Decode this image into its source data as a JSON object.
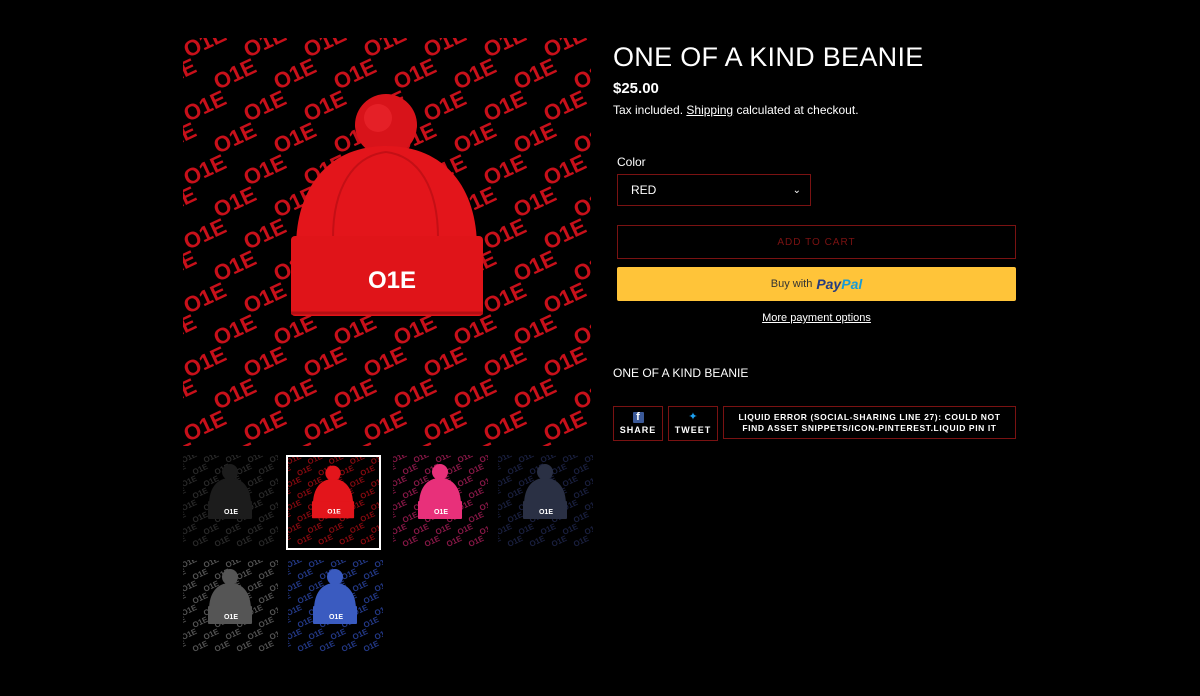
{
  "product": {
    "title": "ONE OF A KIND BEANIE",
    "price": "$25.00",
    "tax_prefix": "Tax included.",
    "shipping_link": "Shipping",
    "tax_suffix": "calculated at checkout.",
    "description": "ONE OF A KIND BEANIE"
  },
  "variant": {
    "label": "Color",
    "selected": "RED"
  },
  "buttons": {
    "add_to_cart": "ADD TO CART",
    "paypal_buy": "Buy with",
    "paypal_brand_1": "Pay",
    "paypal_brand_2": "Pal",
    "more_payment": "More payment options"
  },
  "share": {
    "facebook_label": "SHARE",
    "twitter_label": "TWEET",
    "error_text": "LIQUID ERROR (SOCIAL-SHARING LINE 27): COULD NOT FIND ASSET SNIPPETS/ICON-PINTEREST.LIQUID PIN IT"
  },
  "gallery": {
    "main_logo": "O1E",
    "thumbnails": [
      {
        "name": "black",
        "beanie": "#1c1c1c",
        "pattern": "#2a2a2a",
        "active": false
      },
      {
        "name": "red",
        "beanie": "#e3151b",
        "pattern": "#8a0a10",
        "active": true
      },
      {
        "name": "pink",
        "beanie": "#e8307a",
        "pattern": "#8a1848",
        "active": false
      },
      {
        "name": "navy",
        "beanie": "#2a3044",
        "pattern": "#1a2040",
        "active": false
      },
      {
        "name": "grey",
        "beanie": "#555555",
        "pattern": "#555555",
        "active": false
      },
      {
        "name": "royal",
        "beanie": "#3a5bc0",
        "pattern": "#243a8a",
        "active": false
      }
    ]
  },
  "colors": {
    "background": "#000000",
    "accent_border": "#7a1212",
    "paypal_yellow": "#ffc439"
  }
}
